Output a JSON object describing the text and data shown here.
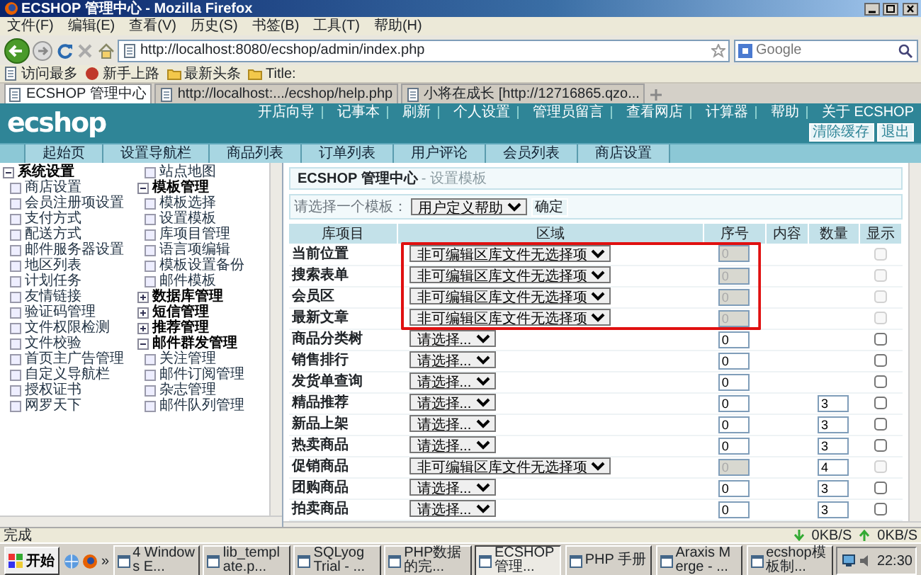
{
  "window": {
    "title": "ECSHOP 管理中心 - Mozilla Firefox"
  },
  "menu": [
    "文件(F)",
    "编辑(E)",
    "查看(V)",
    "历史(S)",
    "书签(B)",
    "工具(T)",
    "帮助(H)"
  ],
  "address_bar": {
    "url": "http://localhost:8080/ecshop/admin/index.php"
  },
  "search": {
    "placeholder": "Google"
  },
  "bookmarks": [
    {
      "label": "访问最多",
      "kind": "page"
    },
    {
      "label": "新手上路",
      "kind": "feed"
    },
    {
      "label": "最新头条",
      "kind": "folder"
    },
    {
      "label": "Title:",
      "kind": "folder"
    }
  ],
  "browser_tabs": [
    {
      "label": "ECSHOP 管理中心",
      "selected": true
    },
    {
      "label": "http://localhost:.../ecshop/help.php",
      "selected": false
    },
    {
      "label": "小将在成长 [http://12716865.qzo...",
      "selected": false
    }
  ],
  "header": {
    "logo": "ecshop",
    "links": [
      "开店向导",
      "记事本",
      "刷新",
      "个人设置",
      "管理员留言",
      "查看网店",
      "计算器",
      "帮助",
      "关于 ECSHOP"
    ],
    "buttons": [
      "清除缓存",
      "退出"
    ]
  },
  "nav_tabs": [
    "起始页",
    "设置导航栏",
    "商品列表",
    "订单列表",
    "用户评论",
    "会员列表",
    "商店设置"
  ],
  "sidebar": {
    "items": [
      {
        "label": "系统设置",
        "expanded": true,
        "children": [
          {
            "label": "商店设置"
          },
          {
            "label": "会员注册项设置"
          },
          {
            "label": "支付方式"
          },
          {
            "label": "配送方式"
          },
          {
            "label": "邮件服务器设置"
          },
          {
            "label": "地区列表"
          },
          {
            "label": "计划任务"
          },
          {
            "label": "友情链接"
          },
          {
            "label": "验证码管理"
          },
          {
            "label": "文件权限检测"
          },
          {
            "label": "文件校验"
          },
          {
            "label": "首页主广告管理"
          },
          {
            "label": "自定义导航栏"
          },
          {
            "label": "授权证书"
          },
          {
            "label": "网罗天下"
          },
          {
            "label": "站点地图"
          }
        ]
      },
      {
        "label": "模板管理",
        "expanded": true,
        "children": [
          {
            "label": "模板选择"
          },
          {
            "label": "设置模板"
          },
          {
            "label": "库项目管理"
          },
          {
            "label": "语言项编辑"
          },
          {
            "label": "模板设置备份"
          },
          {
            "label": "邮件模板"
          }
        ]
      },
      {
        "label": "数据库管理",
        "expanded": false
      },
      {
        "label": "短信管理",
        "expanded": false
      },
      {
        "label": "推荐管理",
        "expanded": false
      },
      {
        "label": "邮件群发管理",
        "expanded": true,
        "children": [
          {
            "label": "关注管理"
          },
          {
            "label": "邮件订阅管理"
          },
          {
            "label": "杂志管理"
          },
          {
            "label": "邮件队列管理"
          }
        ]
      }
    ]
  },
  "page": {
    "title": "ECSHOP 管理中心",
    "subtitle": "- 设置模板"
  },
  "template_picker": {
    "label": "请选择一个模板：",
    "value": "用户定义帮助",
    "button": "确定"
  },
  "table": {
    "columns": [
      "库项目",
      "区域",
      "序号",
      "内容",
      "数量",
      "显示"
    ],
    "rows": [
      {
        "item": "当前位置",
        "region": "非可编辑区库文件无选择项",
        "locked": true,
        "order": "0",
        "show": false
      },
      {
        "item": "搜索表单",
        "region": "非可编辑区库文件无选择项",
        "locked": true,
        "order": "0",
        "show": false
      },
      {
        "item": "会员区",
        "region": "非可编辑区库文件无选择项",
        "locked": true,
        "order": "0",
        "show": false
      },
      {
        "item": "最新文章",
        "region": "非可编辑区库文件无选择项",
        "locked": true,
        "order": "0",
        "show": false
      },
      {
        "item": "商品分类树",
        "region": "请选择...",
        "locked": false,
        "order": "0",
        "show": false
      },
      {
        "item": "销售排行",
        "region": "请选择...",
        "locked": false,
        "order": "0",
        "show": false
      },
      {
        "item": "发货单查询",
        "region": "请选择...",
        "locked": false,
        "order": "0",
        "show": false
      },
      {
        "item": "精品推荐",
        "region": "请选择...",
        "locked": false,
        "order": "0",
        "quantity": "3",
        "show": false
      },
      {
        "item": "新品上架",
        "region": "请选择...",
        "locked": false,
        "order": "0",
        "quantity": "3",
        "show": false
      },
      {
        "item": "热卖商品",
        "region": "请选择...",
        "locked": false,
        "order": "0",
        "quantity": "3",
        "show": false
      },
      {
        "item": "促销商品",
        "region": "非可编辑区库文件无选择项",
        "locked": true,
        "order": "0",
        "quantity": "4",
        "show": false
      },
      {
        "item": "团购商品",
        "region": "请选择...",
        "locked": false,
        "order": "0",
        "quantity": "3",
        "show": false
      },
      {
        "item": "拍卖商品",
        "region": "请选择...",
        "locked": false,
        "order": "0",
        "quantity": "3",
        "show": false
      }
    ]
  },
  "status_bar": {
    "text": "完成",
    "download": "0KB/S",
    "upload": "0KB/S"
  },
  "taskbar": {
    "start": "开始",
    "more": "»",
    "tasks": [
      {
        "label": "4 Windows E...",
        "selected": false
      },
      {
        "label": "lib_template.p...",
        "selected": false
      },
      {
        "label": "SQLyog Trial - ...",
        "selected": false
      },
      {
        "label": "PHP数据的完...",
        "selected": false
      },
      {
        "label": "ECSHOP 管理...",
        "selected": true
      },
      {
        "label": "PHP 手册",
        "selected": false
      },
      {
        "label": "Araxis Merge - ...",
        "selected": false
      },
      {
        "label": "ecshop模板制...",
        "selected": false
      }
    ],
    "clock": "22:30"
  }
}
